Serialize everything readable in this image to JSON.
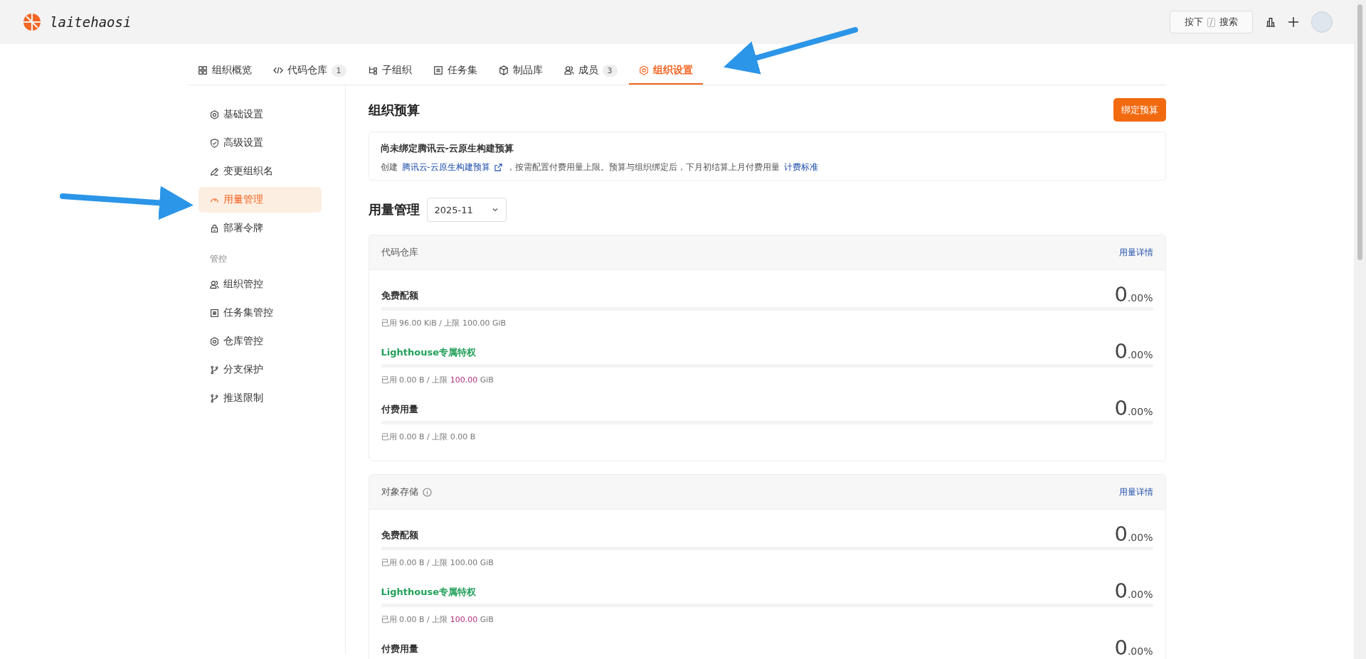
{
  "header": {
    "logo_text": "laitehaosi",
    "search_button": {
      "prefix": "按下",
      "key": "/",
      "label": "搜索"
    }
  },
  "tabs": [
    {
      "label": "组织概览",
      "selected": false
    },
    {
      "label": "代码仓库",
      "count": "1",
      "selected": false
    },
    {
      "label": "子组织",
      "selected": false
    },
    {
      "label": "任务集",
      "selected": false
    },
    {
      "label": "制品库",
      "selected": false
    },
    {
      "label": "成员",
      "count": "3",
      "selected": false
    },
    {
      "label": "组织设置",
      "selected": true
    }
  ],
  "sidebar": {
    "items": [
      {
        "label": "基础设置",
        "selected": false
      },
      {
        "label": "高级设置",
        "selected": false
      },
      {
        "label": "变更组织名",
        "selected": false
      },
      {
        "label": "用量管理",
        "selected": true
      },
      {
        "label": "部署令牌",
        "selected": false
      }
    ],
    "section_title": "管控",
    "section_items": [
      {
        "label": "组织管控",
        "selected": false
      },
      {
        "label": "任务集管控",
        "selected": false
      },
      {
        "label": "仓库管控",
        "selected": false
      },
      {
        "label": "分支保护",
        "selected": false
      },
      {
        "label": "推送限制",
        "selected": false
      }
    ]
  },
  "budget": {
    "title": "组织预算",
    "button": "绑定预算",
    "notice_title": "尚未绑定腾讯云-云原生构建预算",
    "notice_prefix": "创建",
    "notice_link": "腾讯云-云原生构建预算",
    "notice_text": "，按需配置付费用量上限。预算与组织绑定后，下月初结算上月付费用量",
    "notice_link2": "计费标准"
  },
  "usage": {
    "title": "用量管理",
    "month": "2025-11",
    "cards": [
      {
        "title": "代码仓库",
        "info_icon": false,
        "details_link": "用量详情",
        "rows": [
          {
            "kind": "plain",
            "label": "免费配额",
            "percent_int": "0",
            "percent_frac": ".00%",
            "level": 0,
            "usage": "已用 96.00 KiB / 上限",
            "limit": "100.00",
            "unit": "GiB",
            "limit_highlight": false
          },
          {
            "kind": "lighthouse",
            "label": "Lighthouse专属特权",
            "percent_int": "0",
            "percent_frac": ".00%",
            "level": 0,
            "usage": "已用 0.00 B / 上限",
            "limit": "100.00",
            "unit": "GiB",
            "limit_highlight": true
          },
          {
            "kind": "plain",
            "label": "付费用量",
            "percent_int": "0",
            "percent_frac": ".00%",
            "level": 0,
            "usage": "已用 0.00 B / 上限",
            "limit": "0.00",
            "unit": "B",
            "limit_highlight": false
          }
        ]
      },
      {
        "title": "对象存储",
        "info_icon": true,
        "details_link": "用量详情",
        "rows": [
          {
            "kind": "plain",
            "label": "免费配额",
            "percent_int": "0",
            "percent_frac": ".00%",
            "level": 0,
            "usage": "已用 0.00 B / 上限",
            "limit": "100.00",
            "unit": "GiB",
            "limit_highlight": false
          },
          {
            "kind": "lighthouse",
            "label": "Lighthouse专属特权",
            "percent_int": "0",
            "percent_frac": ".00%",
            "level": 0,
            "usage": "已用 0.00 B / 上限",
            "limit": "100.00",
            "unit": "GiB",
            "limit_highlight": true
          },
          {
            "kind": "plain",
            "label": "付费用量",
            "percent_int": "0",
            "percent_frac": ".00%",
            "level": 0
          }
        ]
      }
    ]
  }
}
